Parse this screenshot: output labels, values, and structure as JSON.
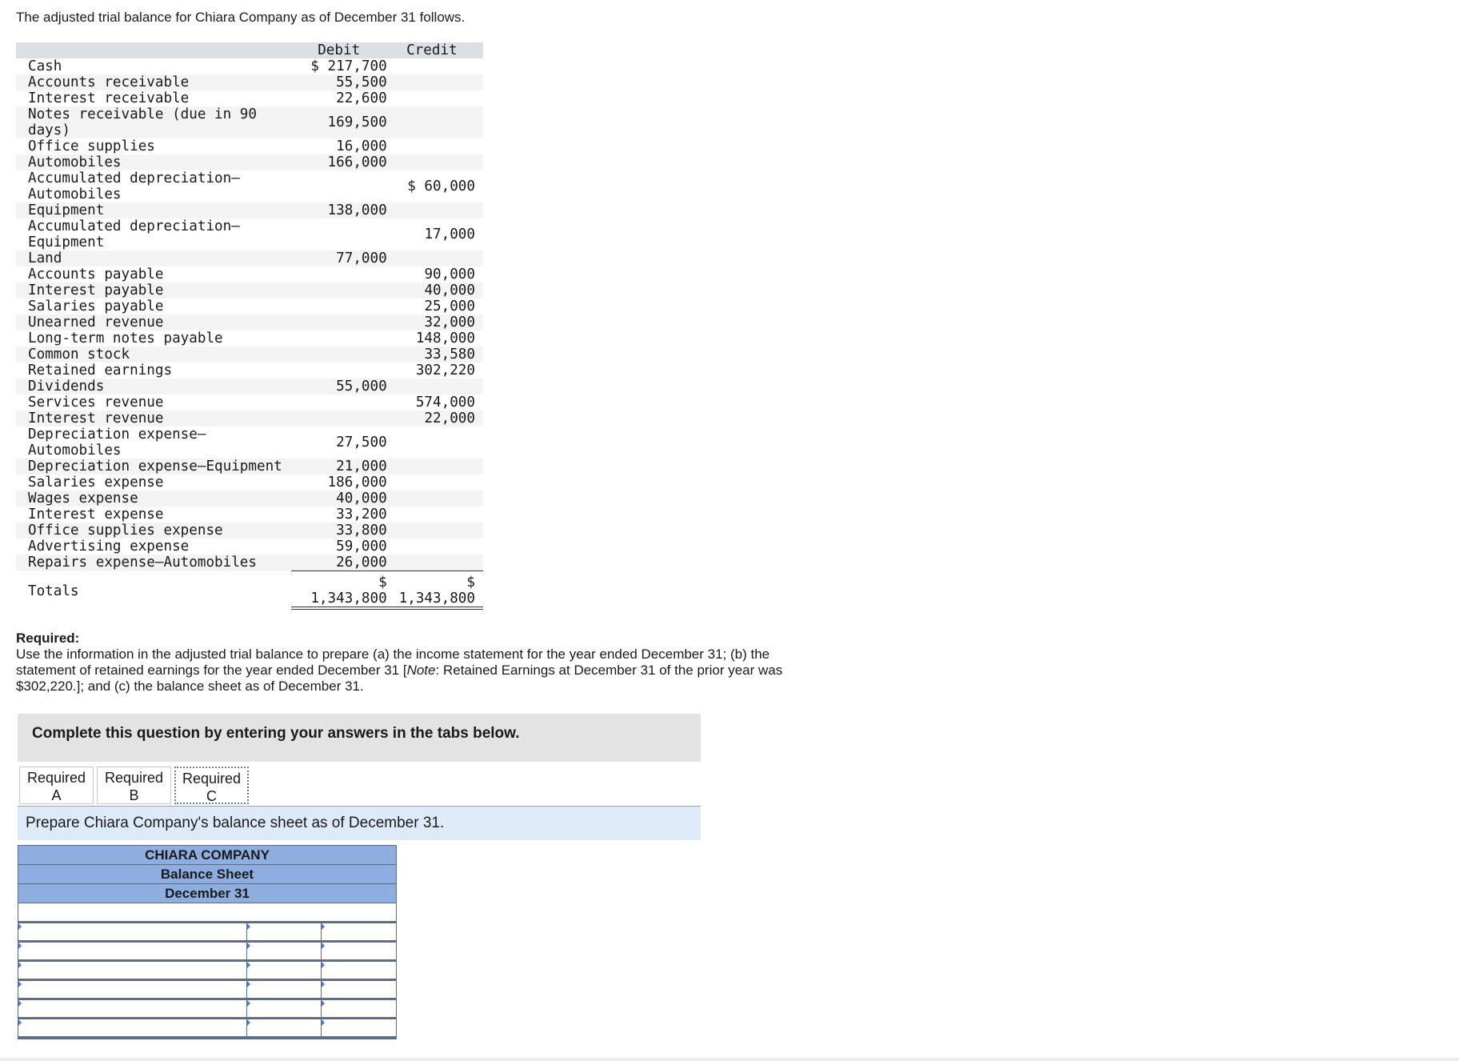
{
  "intro": "The adjusted trial balance for Chiara Company as of December 31 follows.",
  "trial_balance": {
    "headers": {
      "debit": "Debit",
      "credit": "Credit"
    },
    "rows": [
      {
        "account": "Cash",
        "debit": "$ 217,700",
        "credit": ""
      },
      {
        "account": "Accounts receivable",
        "debit": "55,500",
        "credit": ""
      },
      {
        "account": "Interest receivable",
        "debit": "22,600",
        "credit": ""
      },
      {
        "account": "Notes receivable (due in 90 days)",
        "debit": "169,500",
        "credit": ""
      },
      {
        "account": "Office supplies",
        "debit": "16,000",
        "credit": ""
      },
      {
        "account": "Automobiles",
        "debit": "166,000",
        "credit": ""
      },
      {
        "account": "Accumulated depreciation–Automobiles",
        "debit": "",
        "credit": "$ 60,000"
      },
      {
        "account": "Equipment",
        "debit": "138,000",
        "credit": ""
      },
      {
        "account": "Accumulated depreciation–Equipment",
        "debit": "",
        "credit": "17,000"
      },
      {
        "account": "Land",
        "debit": "77,000",
        "credit": ""
      },
      {
        "account": "Accounts payable",
        "debit": "",
        "credit": "90,000"
      },
      {
        "account": "Interest payable",
        "debit": "",
        "credit": "40,000"
      },
      {
        "account": "Salaries payable",
        "debit": "",
        "credit": "25,000"
      },
      {
        "account": "Unearned revenue",
        "debit": "",
        "credit": "32,000"
      },
      {
        "account": "Long-term notes payable",
        "debit": "",
        "credit": "148,000"
      },
      {
        "account": "Common stock",
        "debit": "",
        "credit": "33,580"
      },
      {
        "account": "Retained earnings",
        "debit": "",
        "credit": "302,220"
      },
      {
        "account": "Dividends",
        "debit": "55,000",
        "credit": ""
      },
      {
        "account": "Services revenue",
        "debit": "",
        "credit": "574,000"
      },
      {
        "account": "Interest revenue",
        "debit": "",
        "credit": "22,000"
      },
      {
        "account": "Depreciation expense–Automobiles",
        "debit": "27,500",
        "credit": ""
      },
      {
        "account": "Depreciation expense–Equipment",
        "debit": "21,000",
        "credit": ""
      },
      {
        "account": "Salaries expense",
        "debit": "186,000",
        "credit": ""
      },
      {
        "account": "Wages expense",
        "debit": "40,000",
        "credit": ""
      },
      {
        "account": "Interest expense",
        "debit": "33,200",
        "credit": ""
      },
      {
        "account": "Office supplies expense",
        "debit": "33,800",
        "credit": ""
      },
      {
        "account": "Advertising expense",
        "debit": "59,000",
        "credit": ""
      },
      {
        "account": "Repairs expense–Automobiles",
        "debit": "26,000",
        "credit": ""
      }
    ],
    "totals": {
      "label": "Totals",
      "currency": "$",
      "debit": "1,343,800",
      "credit": "1,343,800"
    }
  },
  "required": {
    "heading": "Required:",
    "text_1": "Use the information in the adjusted trial balance to prepare (a) the income statement for the year ended December 31; (b) the statement of retained earnings for the year ended December 31 [",
    "note_label": "Note",
    "text_2": ": Retained Earnings at December 31 of the prior year was $302,220.]; and (c) the balance sheet as of December 31."
  },
  "banner": "Complete this question by entering your answers in the tabs below.",
  "tabs": [
    {
      "line1": "Required",
      "line2": "A"
    },
    {
      "line1": "Required",
      "line2": "B"
    },
    {
      "line1": "Required",
      "line2": "C"
    }
  ],
  "active_tab": "Required C",
  "instruction": "Prepare Chiara Company's balance sheet as of December 31.",
  "balance_sheet": {
    "company": "CHIARA COMPANY",
    "title": "Balance Sheet",
    "date": "December 31"
  }
}
